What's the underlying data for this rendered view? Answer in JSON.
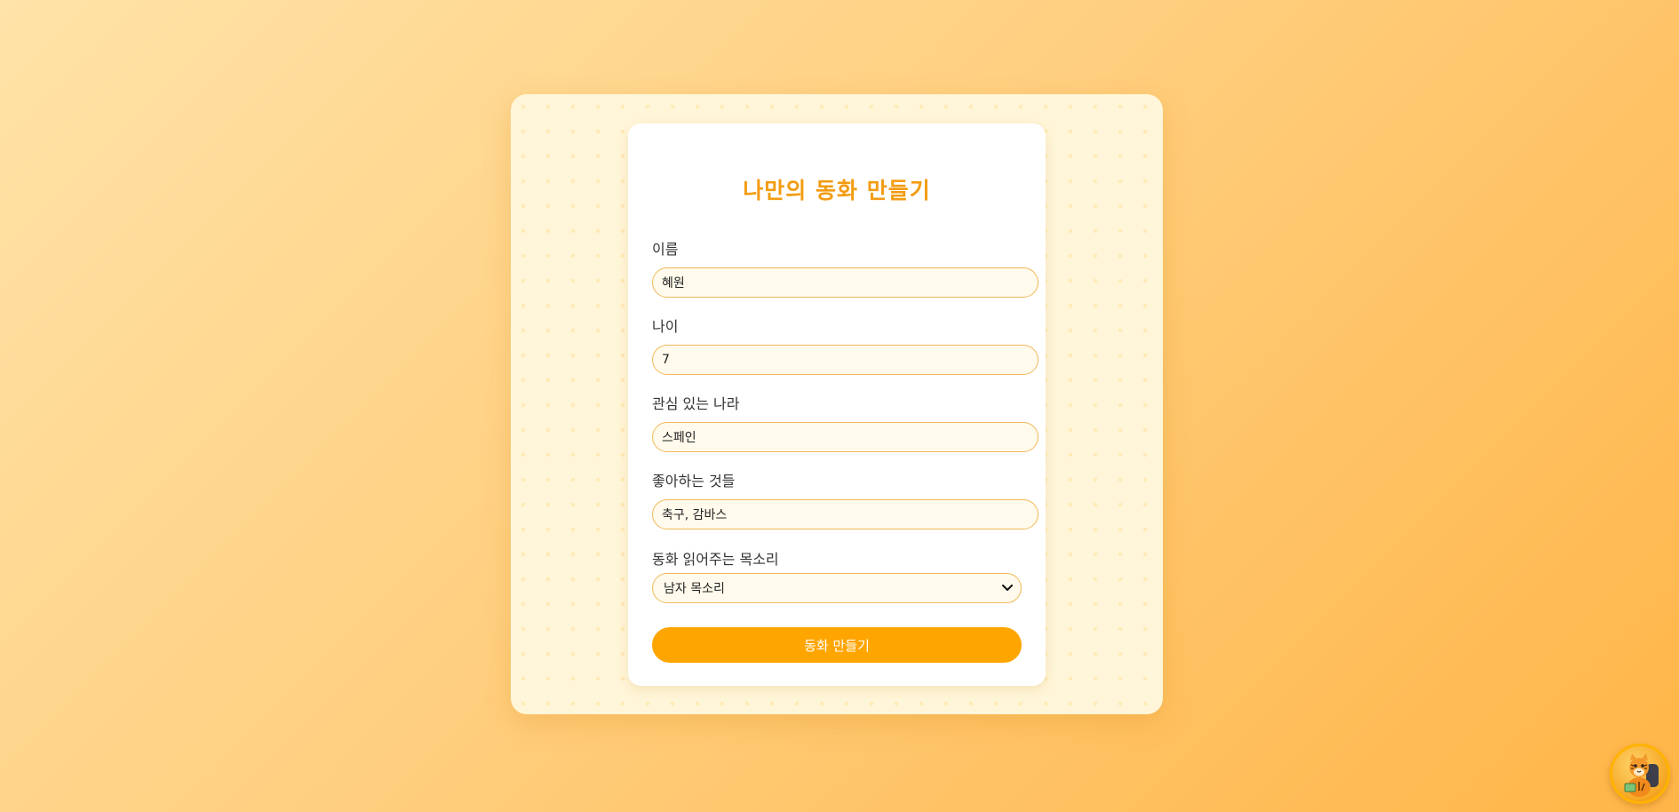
{
  "form": {
    "title": "나만의 동화 만들기",
    "fields": [
      {
        "label": "이름",
        "value": "혜원"
      },
      {
        "label": "나이",
        "value": "7"
      },
      {
        "label": "관심 있는 나라",
        "value": "스페인"
      },
      {
        "label": "좋아하는 것들",
        "value": "축구, 감바스"
      }
    ],
    "voice": {
      "label": "동화 읽어주는 목소리",
      "selected": "남자 목소리"
    },
    "submit_label": "동화 만들기"
  },
  "colors": {
    "accent": "#ffa500",
    "title": "#f39c12",
    "input_border": "#f0b95a",
    "input_bg": "#fffaeb"
  },
  "icons": {
    "select_arrow": "chevron-down-icon",
    "mascot": "tiger-mascot-icon"
  }
}
